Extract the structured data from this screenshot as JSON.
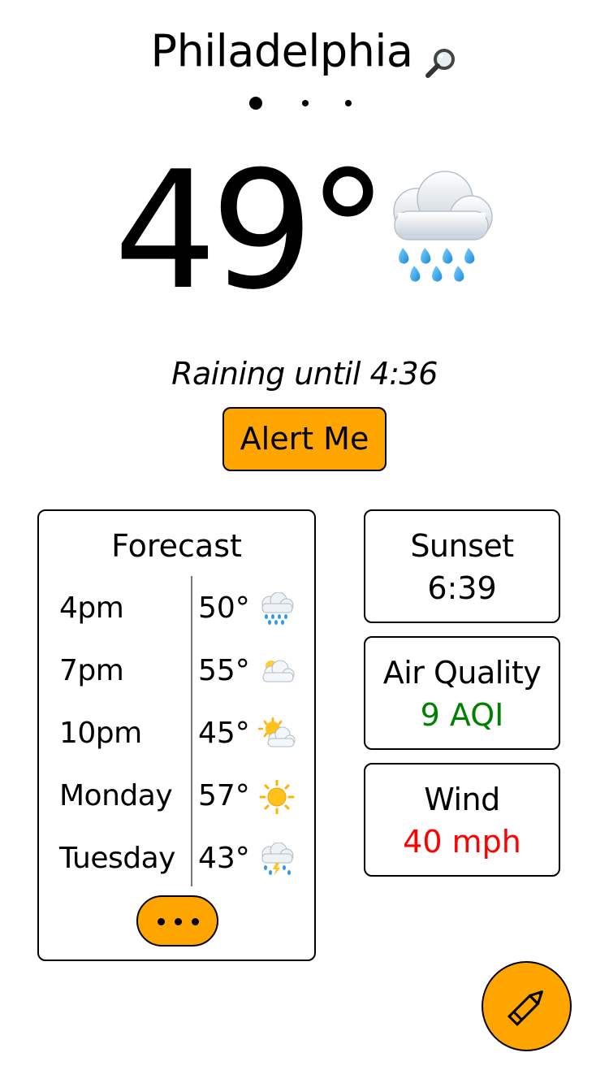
{
  "header": {
    "city": "Philadelphia",
    "search_icon": "magnifying-glass-icon",
    "pages": {
      "count": 3,
      "active_index": 0
    }
  },
  "current": {
    "temperature": "49°",
    "icon": "cloud-with-rain-icon",
    "condition": "Raining until 4:36",
    "alert_button_label": "Alert Me"
  },
  "forecast": {
    "title": "Forecast",
    "rows": [
      {
        "time": "4pm",
        "temp": "50°",
        "icon": "cloud-with-rain-icon"
      },
      {
        "time": "7pm",
        "temp": "55°",
        "icon": "cloud-icon"
      },
      {
        "time": "10pm",
        "temp": "45°",
        "icon": "sun-behind-cloud-icon"
      },
      {
        "time": "Monday",
        "temp": "57°",
        "icon": "sun-icon"
      },
      {
        "time": "Tuesday",
        "temp": "43°",
        "icon": "cloud-with-lightning-and-rain-icon"
      }
    ],
    "more_button_icon": "ellipsis-icon"
  },
  "info": {
    "sunset": {
      "label": "Sunset",
      "value": "6:39"
    },
    "air_quality": {
      "label": "Air Quality",
      "value": "9 AQI",
      "color": "#008000"
    },
    "wind": {
      "label": "Wind",
      "value": "40 mph",
      "color": "#FF0000"
    }
  },
  "fab": {
    "icon": "pencil-icon"
  },
  "colors": {
    "accent": "#FFA500",
    "border": "#000000",
    "divider": "#777777",
    "background": "#FFFFFF"
  }
}
